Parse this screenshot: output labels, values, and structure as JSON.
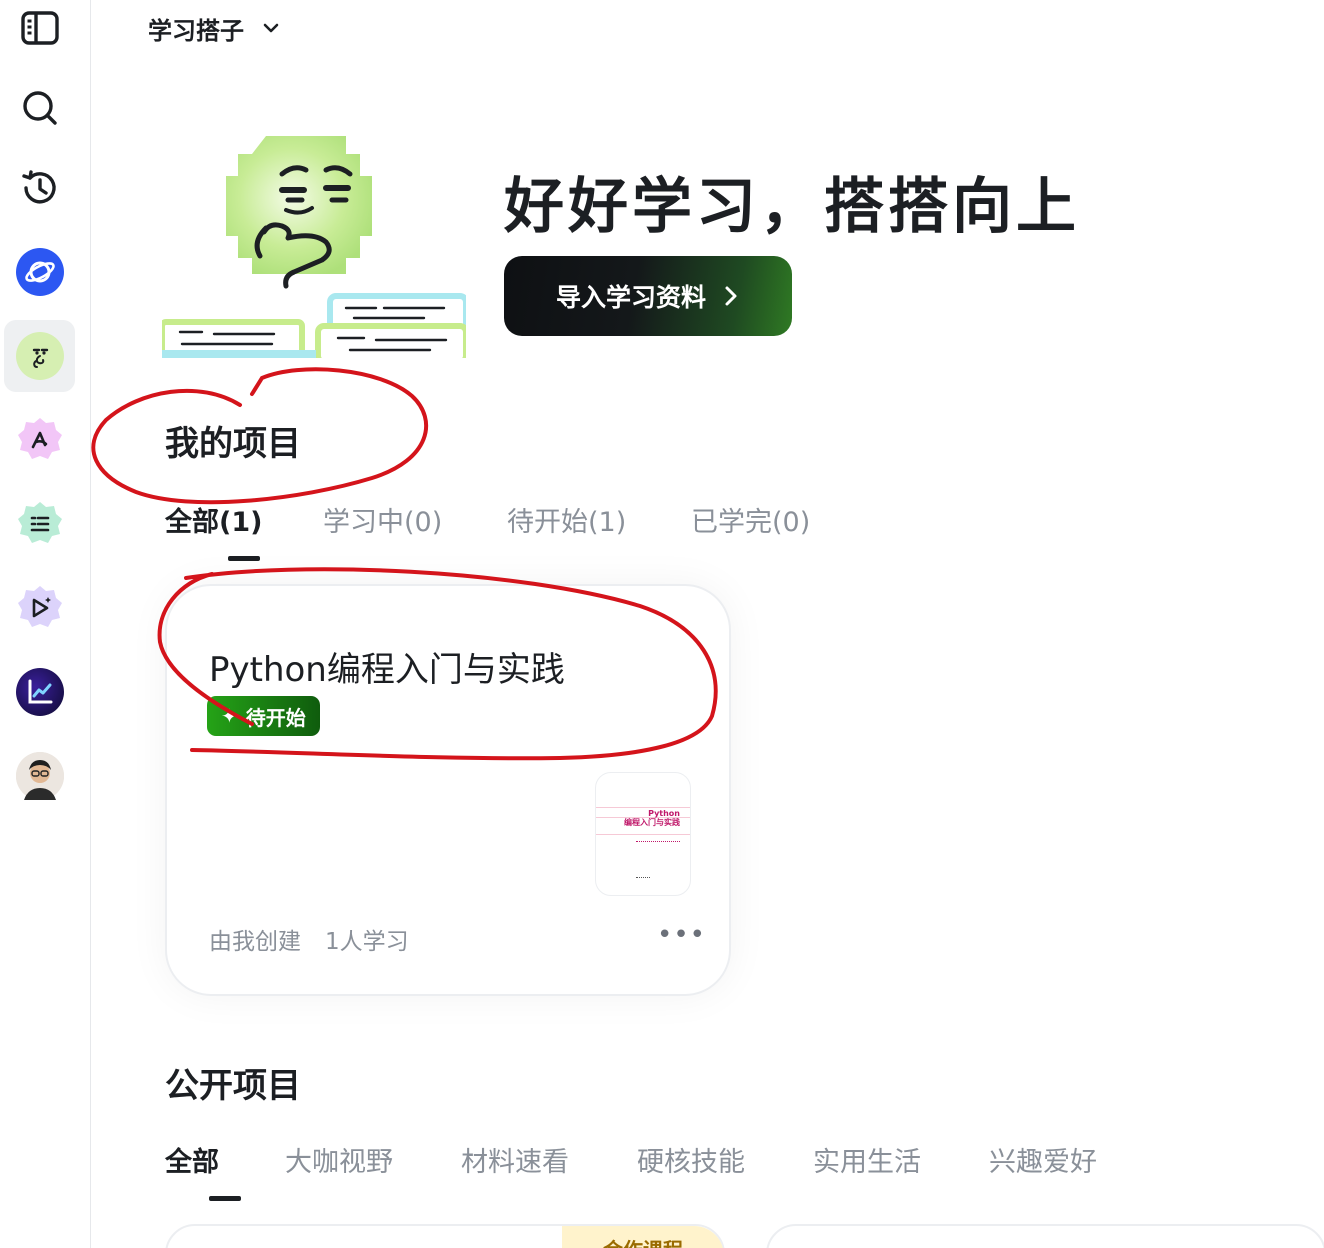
{
  "header": {
    "title": "学习搭子"
  },
  "sidebar": {
    "items": [
      {
        "name": "panel-toggle"
      },
      {
        "name": "search"
      },
      {
        "name": "history"
      },
      {
        "name": "app-blue"
      },
      {
        "name": "study-buddy"
      },
      {
        "name": "app-pink"
      },
      {
        "name": "app-teal"
      },
      {
        "name": "app-purple"
      },
      {
        "name": "app-chart"
      },
      {
        "name": "user-avatar"
      }
    ]
  },
  "hero": {
    "title": "好好学习，搭搭向上",
    "import_button": "导入学习资料"
  },
  "my_projects": {
    "title": "我的项目",
    "tabs": [
      "全部(1)",
      "学习中(0)",
      "待开始(1)",
      "已学完(0)"
    ],
    "active_tab": 0,
    "cards": [
      {
        "title": "Python编程入门与实践",
        "status": "待开始",
        "thumb_title_line1": "Python",
        "thumb_title_line2": "编程入门与实践",
        "footer_creator": "由我创建",
        "footer_learners": "1人学习",
        "more": "•••"
      }
    ]
  },
  "public_projects": {
    "title": "公开项目",
    "tabs": [
      "全部",
      "大咖视野",
      "材料速看",
      "硬核技能",
      "实用生活",
      "兴趣爱好"
    ],
    "active_tab": 0,
    "partial_badge": "合作课程"
  },
  "colors": {
    "accent_green": "#25a317",
    "dark_button": "#0e1013",
    "annotation_red": "#d4141b"
  }
}
